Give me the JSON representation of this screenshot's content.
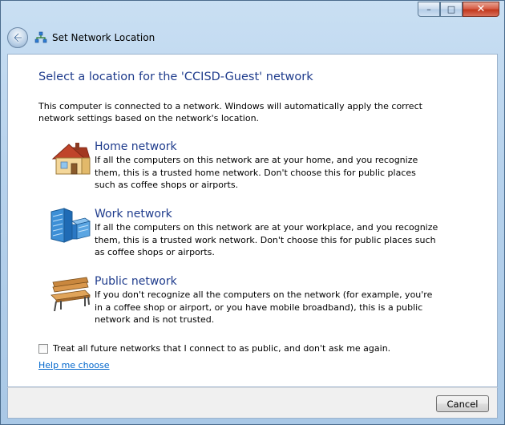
{
  "window": {
    "title": "Set Network Location",
    "caption": {
      "minimize": "–",
      "maximize": "□",
      "close": "✕"
    }
  },
  "content": {
    "heading": "Select a location for the 'CCISD-Guest' network",
    "intro": "This computer is connected to a network. Windows will automatically apply the correct network settings based on the network's location.",
    "options": [
      {
        "title": "Home network",
        "description": "If all the computers on this network are at your home, and you recognize them, this is a trusted home network.  Don't choose this for public places such as coffee shops or airports.",
        "icon": "house-icon"
      },
      {
        "title": "Work network",
        "description": "If all the computers on this network are at your workplace, and you recognize them, this is a trusted work network.  Don't choose this for public places such as coffee shops or airports.",
        "icon": "office-building-icon"
      },
      {
        "title": "Public network",
        "description": "If you don't recognize all the computers on the network (for example, you're in a coffee shop or airport, or you have mobile broadband), this is a public network and is not trusted.",
        "icon": "park-bench-icon"
      }
    ],
    "checkbox_label": "Treat all future networks that I connect to as public, and don't ask me again.",
    "checkbox_checked": false,
    "help_link": "Help me choose"
  },
  "footer": {
    "cancel_label": "Cancel"
  },
  "colors": {
    "heading": "#1e3b8c",
    "link": "#0066cc",
    "frame": "#b7d2ec"
  }
}
